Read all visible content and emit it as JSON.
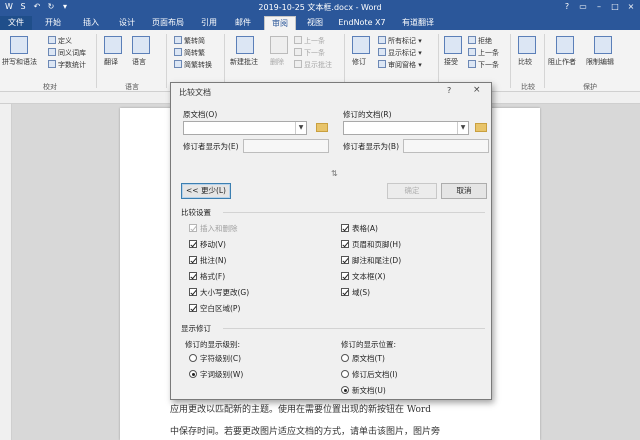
{
  "window": {
    "title": "2019-10-25 文本框.docx - Word",
    "controls": [
      "?",
      "▭",
      "–",
      "□",
      "×"
    ]
  },
  "quick_access": [
    "W",
    "S",
    "↶",
    "↻",
    "▾"
  ],
  "tabs": [
    {
      "label": "文件"
    },
    {
      "label": "开始"
    },
    {
      "label": "插入"
    },
    {
      "label": "设计"
    },
    {
      "label": "页面布局"
    },
    {
      "label": "引用"
    },
    {
      "label": "邮件"
    },
    {
      "label": "审阅"
    },
    {
      "label": "视图"
    },
    {
      "label": "EndNote X7"
    },
    {
      "label": "有道翻译"
    }
  ],
  "ribbon": {
    "proofing": {
      "spell": "拼写和语法",
      "define": "定义",
      "thesaurus": "同义词库",
      "wordcount": "字数统计",
      "group": "校对"
    },
    "language": {
      "translate": "翻译",
      "language": "语言",
      "group": "语言"
    },
    "chinese": {
      "t2s": "繁转简",
      "s2t": "简转繁",
      "convert": "简繁转换"
    },
    "comments": {
      "new": "新建批注",
      "delete": "删除",
      "prev": "上一条",
      "next": "下一条",
      "show": "显示批注"
    },
    "tracking": {
      "track": "修订",
      "markup": "所有标记",
      "show_markup": "显示标记",
      "pane": "审阅窗格"
    },
    "changes": {
      "accept": "接受",
      "reject": "拒绝",
      "prev": "上一条",
      "next": "下一条"
    },
    "compare": {
      "compare": "比较",
      "group": "比较"
    },
    "protect": {
      "block": "阻止作者",
      "restrict": "限制编辑",
      "group": "保护"
    }
  },
  "document": {
    "line1": "应用更改以匹配新的主题。使用在需要位置出现的新按钮在 Word",
    "line2": "中保存时间。若要更改图片适应文档的方式，请单击该图片，图片旁"
  },
  "dialog": {
    "title": "比较文档",
    "help": "?",
    "close": "×",
    "original_label": "原文档(O)",
    "revised_label": "修订的文档(R)",
    "original_author_label": "修订者显示为(E)",
    "revised_author_label": "修订者显示为(B)",
    "less_button": "<< 更少(L)",
    "ok_button": "确定",
    "cancel_button": "取消",
    "settings_header": "比较设置",
    "settings_left": [
      {
        "label": "插入和删除",
        "checked": true,
        "disabled": true
      },
      {
        "label": "移动(V)",
        "checked": true,
        "disabled": false
      },
      {
        "label": "批注(N)",
        "checked": true,
        "disabled": false
      },
      {
        "label": "格式(F)",
        "checked": true,
        "disabled": false
      },
      {
        "label": "大小写更改(G)",
        "checked": true,
        "disabled": false
      },
      {
        "label": "空白区域(P)",
        "checked": true,
        "disabled": false
      }
    ],
    "settings_right": [
      {
        "label": "表格(A)",
        "checked": true
      },
      {
        "label": "页眉和页脚(H)",
        "checked": true
      },
      {
        "label": "脚注和尾注(D)",
        "checked": true
      },
      {
        "label": "文本框(X)",
        "checked": true
      },
      {
        "label": "域(S)",
        "checked": true
      }
    ],
    "show_changes_header": "显示修订",
    "level_header": "修订的显示级别:",
    "level_options": [
      {
        "label": "字符级别(C)",
        "selected": false
      },
      {
        "label": "字词级别(W)",
        "selected": true
      }
    ],
    "location_header": "修订的显示位置:",
    "location_options": [
      {
        "label": "原文档(T)",
        "selected": false
      },
      {
        "label": "修订后文档(I)",
        "selected": false
      },
      {
        "label": "新文档(U)",
        "selected": true
      }
    ]
  }
}
